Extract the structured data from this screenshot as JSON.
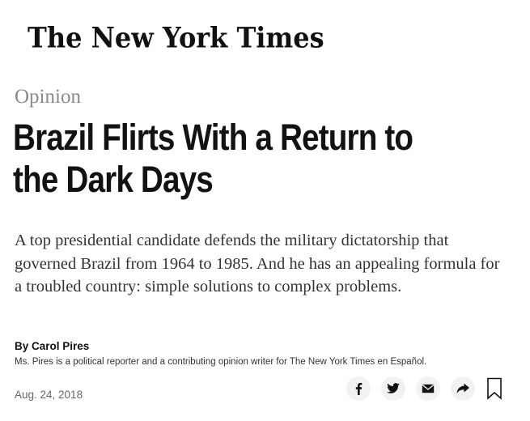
{
  "masthead": {
    "logo_text": "The New York Times"
  },
  "article": {
    "section": "Opinion",
    "headline": "Brazil Flirts With a Return to the Dark Days",
    "dek": "A top presidential candidate defends the military dictatorship that governed Brazil from 1964 to 1985. And he has an appealing formula for a troubled country: simple solutions to complex problems.",
    "byline": "By Carol Pires",
    "author_bio": "Ms. Pires is a political reporter and a contributing opinion writer for The New York Times en Español.",
    "date": "Aug. 24, 2018"
  },
  "share_tools": {
    "icons": [
      "facebook-icon",
      "twitter-icon",
      "email-icon",
      "share-icon",
      "bookmark-icon"
    ]
  }
}
